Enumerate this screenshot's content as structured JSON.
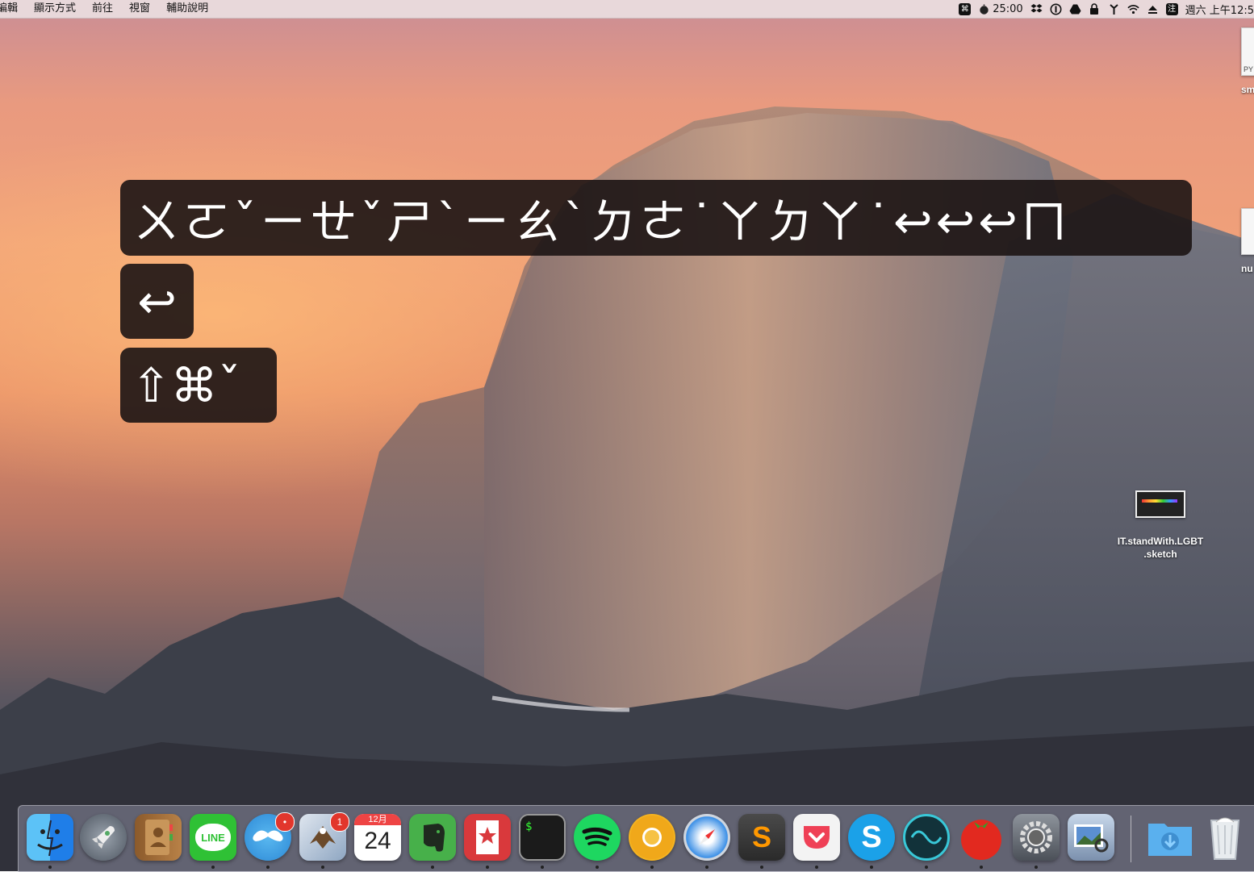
{
  "menubar": {
    "menus": [
      "編輯",
      "顯示方式",
      "前往",
      "視窗",
      "輔助說明"
    ],
    "status": {
      "cmd_icon_label": "⌘",
      "timer": "25:00",
      "ime_label": "注",
      "clock": "週六 上午12:5"
    }
  },
  "overlays": {
    "line1": "ㄨㄛˇㄧㄝˇㄕˋㄧㄠˋㄉㄜ˙ㄚㄉㄚ˙↩↩↩ㄇ",
    "line2": "↩",
    "line3": "⇧⌘ˇ"
  },
  "desktop_icons": {
    "top_file_badge": "PY",
    "top_file_label": "sm",
    "mid_file_label": "nu",
    "sketch_label_1": "IT.standWith.LGBT",
    "sketch_label_2": ".sketch"
  },
  "dock": {
    "line_label": "LINE",
    "maps_badge": "•",
    "mail_badge": "1",
    "calendar_month": "12月",
    "calendar_day": "24",
    "terminal_prompt": "$",
    "sublime_label": "S",
    "skype_label": "S"
  },
  "colors": {
    "menubar_bg": "#ece2e4",
    "overlay_bg": "#1c1414",
    "badge_red": "#e2362c"
  }
}
